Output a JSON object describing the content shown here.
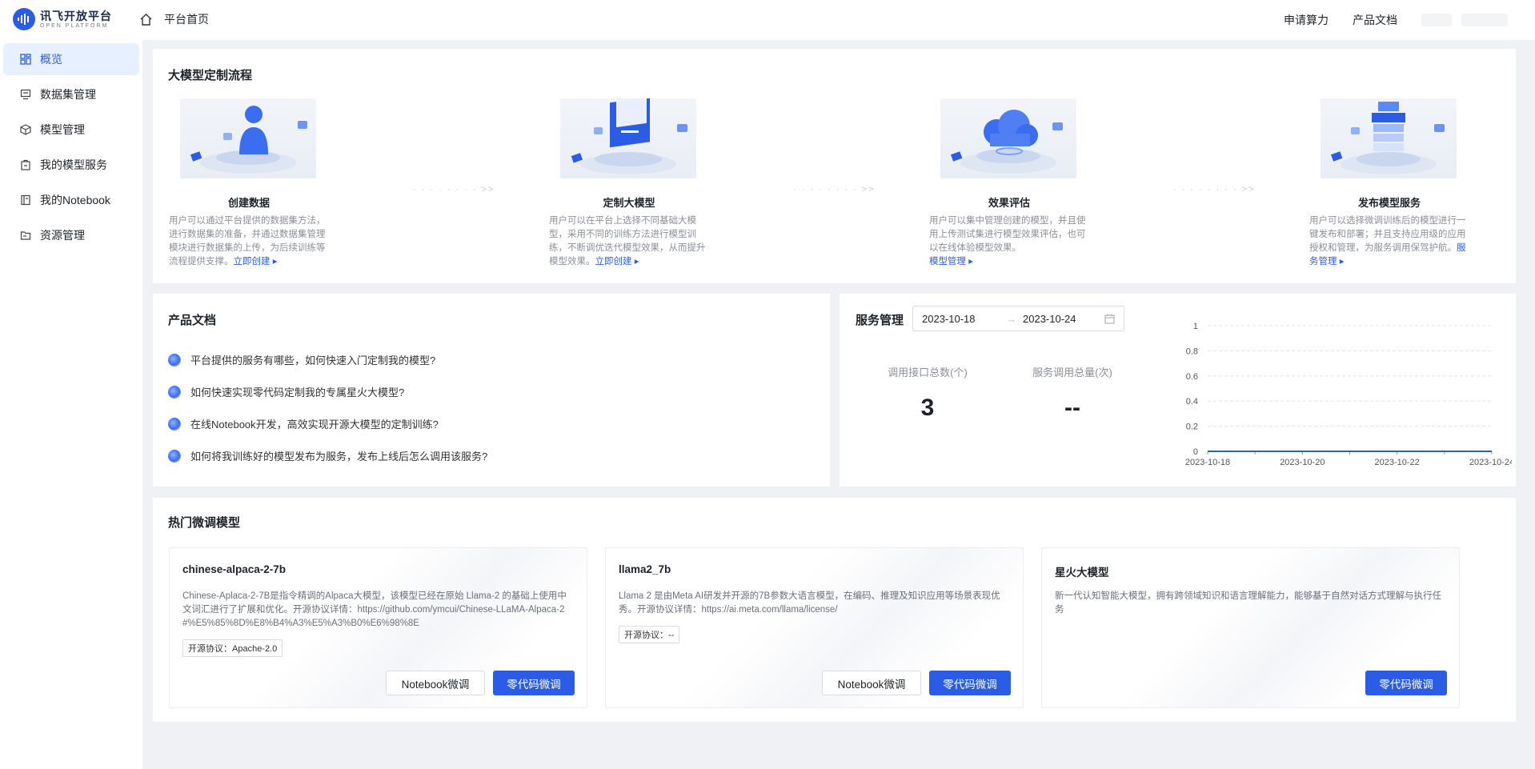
{
  "header": {
    "logo_cn": "讯飞开放平台",
    "logo_en": "OPEN PLATFORM",
    "home_label": "平台首页",
    "links": [
      "申请算力",
      "产品文档"
    ]
  },
  "sidebar": {
    "items": [
      {
        "label": "概览",
        "icon": "dashboard-icon",
        "active": true
      },
      {
        "label": "数据集管理",
        "icon": "dataset-icon"
      },
      {
        "label": "模型管理",
        "icon": "cube-icon"
      },
      {
        "label": "我的模型服务",
        "icon": "service-icon"
      },
      {
        "label": "我的Notebook",
        "icon": "notebook-icon"
      },
      {
        "label": "资源管理",
        "icon": "folder-icon"
      }
    ]
  },
  "flow": {
    "title": "大模型定制流程",
    "steps": [
      {
        "title": "创建数据",
        "desc": "用户可以通过平台提供的数据集方法，进行数据集的准备，并通过数据集管理模块进行数据集的上传，为后续训练等流程提供支撑。",
        "link": "立即创建"
      },
      {
        "title": "定制大模型",
        "desc": "用户可以在平台上选择不同基础大模型，采用不同的训练方法进行模型训练，不断调优迭代模型效果，从而提升模型效果。",
        "link": "立即创建"
      },
      {
        "title": "效果评估",
        "desc": "用户可以集中管理创建的模型，并且使用上传测试集进行模型效果评估，也可以在线体验模型效果。",
        "link": "模型管理"
      },
      {
        "title": "发布模型服务",
        "desc": "用户可以选择微调训练后的模型进行一键发布和部署；并且支持应用级的应用授权和管理，为服务调用保驾护航。",
        "link": "服务管理"
      }
    ],
    "arrow": "· · · · · · · · >>"
  },
  "docs": {
    "title": "产品文档",
    "items": [
      "平台提供的服务有哪些，如何快速入门定制我的模型?",
      "如何快速实现零代码定制我的专属星火大模型?",
      "在线Notebook开发，高效实现开源大模型的定制训练?",
      "如何将我训练好的模型发布为服务，发布上线后怎么调用该服务?"
    ]
  },
  "service": {
    "title": "服务管理",
    "date_start": "2023-10-18",
    "date_end": "2023-10-24",
    "range_arrow": "→",
    "stat1_label": "调用接口总数(个)",
    "stat1_value": "3",
    "stat2_label": "服务调用总量(次)",
    "stat2_value": "--"
  },
  "chart_data": {
    "type": "line",
    "x": [
      "2023-10-18",
      "2023-10-19",
      "2023-10-20",
      "2023-10-21",
      "2023-10-22",
      "2023-10-23",
      "2023-10-24"
    ],
    "x_tick_labels": [
      "2023-10-18",
      "2023-10-20",
      "2023-10-22",
      "2023-10-24"
    ],
    "values": [
      0,
      0,
      0,
      0,
      0,
      0,
      0
    ],
    "ylim": [
      0,
      1
    ],
    "y_ticks": [
      "0",
      "0.2",
      "0.4",
      "0.6",
      "0.8",
      "1"
    ],
    "grid": true,
    "line_color": "#2b5ce6"
  },
  "hot": {
    "title": "热门微调模型",
    "models": [
      {
        "name": "chinese-alpaca-2-7b",
        "desc": "Chinese-Aplaca-2-7B是指令精调的Alpaca大模型，该模型已经在原始 Llama-2 的基础上使用中文词汇进行了扩展和优化。开源协议详情：https://github.com/ymcui/Chinese-LLaMA-Alpaca-2#%E5%85%8D%E8%B4%A3%E5%A3%B0%E6%98%8E",
        "license": "开源协议：Apache-2.0",
        "btn_notebook": "Notebook微调",
        "btn_zero": "零代码微调"
      },
      {
        "name": "llama2_7b",
        "desc": "Llama 2 是由Meta AI研发并开源的7B参数大语言模型，在编码、推理及知识应用等场景表现优秀。开源协议详情：https://ai.meta.com/llama/license/",
        "license": "开源协议：--",
        "btn_notebook": "Notebook微调",
        "btn_zero": "零代码微调"
      },
      {
        "name": "星火大模型",
        "desc": "新一代认知智能大模型，拥有跨领域知识和语言理解能力，能够基于自然对话方式理解与执行任务",
        "btn_zero": "零代码微调"
      }
    ]
  }
}
